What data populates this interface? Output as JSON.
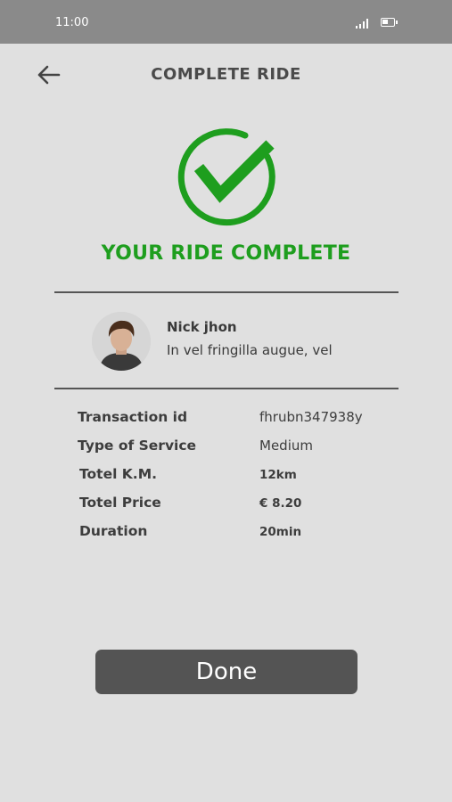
{
  "status_bar": {
    "time": "11:00"
  },
  "header": {
    "title": "COMPLETE RIDE"
  },
  "success": {
    "title": "YOUR RIDE COMPLETE"
  },
  "driver": {
    "name": "Nick jhon",
    "description": "In vel fringilla augue, vel"
  },
  "details": [
    {
      "label": "Transaction id",
      "value": "fhrubn347938y"
    },
    {
      "label": "Type of Service",
      "value": "Medium"
    },
    {
      "label": "Totel K.M.",
      "value": "12km"
    },
    {
      "label": "Totel Price",
      "value": "€ 8.20"
    },
    {
      "label": "Duration",
      "value": "20min"
    }
  ],
  "actions": {
    "done_label": "Done"
  },
  "colors": {
    "success_green": "#1e9e1e",
    "status_bar": "#8a8a8a",
    "background": "#e0e0e0",
    "button": "#545454"
  },
  "icons": {
    "back": "arrow-left-icon",
    "check": "check-circle-icon",
    "signal": "signal-icon",
    "battery": "battery-icon"
  }
}
